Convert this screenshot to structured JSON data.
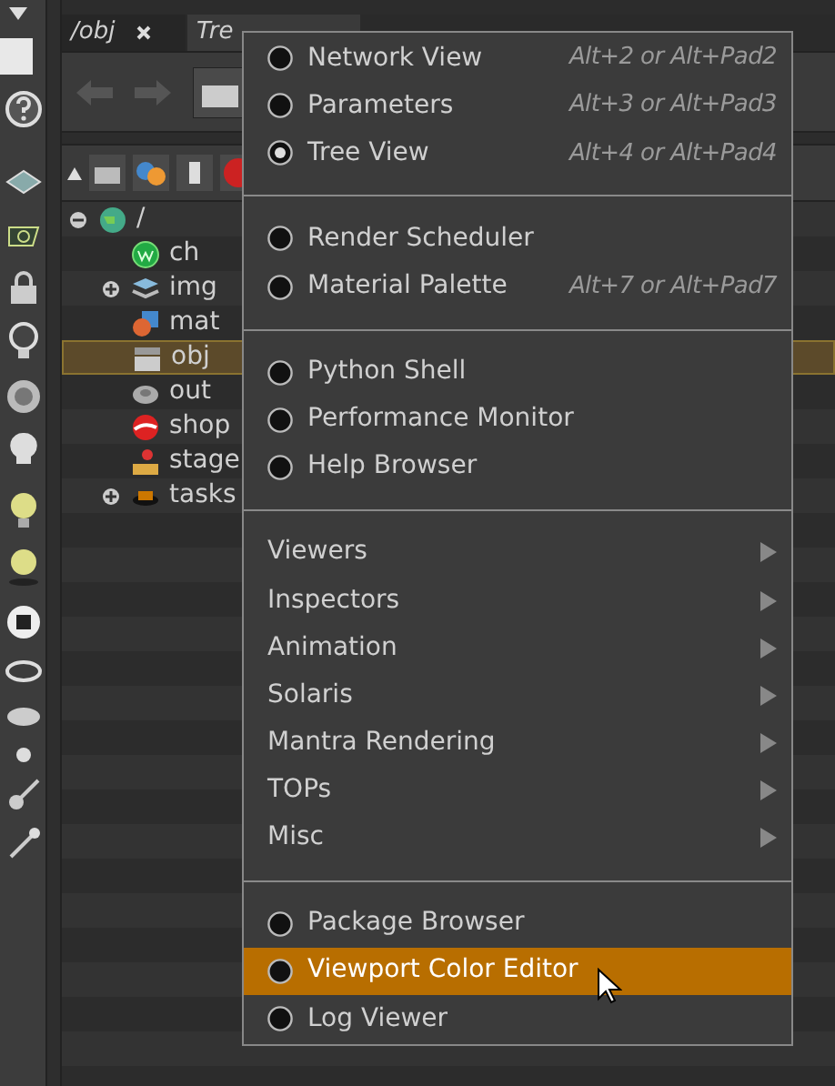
{
  "tabs": [
    {
      "label": "/obj",
      "selected": false,
      "closable": true
    },
    {
      "label": "Tre",
      "selected": true,
      "closable": false
    }
  ],
  "tree": [
    {
      "label": "/",
      "expanded": true,
      "selected": false,
      "children": [
        {
          "label": "ch",
          "selected": false
        },
        {
          "label": "img",
          "selected": false,
          "expanded": false
        },
        {
          "label": "mat",
          "selected": false
        },
        {
          "label": "obj",
          "selected": true
        },
        {
          "label": "out",
          "selected": false
        },
        {
          "label": "shop",
          "selected": false
        },
        {
          "label": "stage",
          "selected": false
        },
        {
          "label": "tasks",
          "selected": false,
          "expanded": false
        }
      ]
    }
  ],
  "menu": [
    {
      "kind": "radio",
      "label": "Network View",
      "shortcut": "Alt+2 or Alt+Pad2",
      "checked": false,
      "selected": false
    },
    {
      "kind": "radio",
      "label": "Parameters",
      "shortcut": "Alt+3 or Alt+Pad3",
      "checked": false,
      "selected": false
    },
    {
      "kind": "radio",
      "label": "Tree View",
      "shortcut": "Alt+4 or Alt+Pad4",
      "checked": true,
      "selected": false
    },
    {
      "kind": "separator"
    },
    {
      "kind": "radio",
      "label": "Render Scheduler",
      "checked": false,
      "selected": false
    },
    {
      "kind": "radio",
      "label": "Material Palette",
      "shortcut": "Alt+7 or Alt+Pad7",
      "checked": false,
      "selected": false
    },
    {
      "kind": "separator"
    },
    {
      "kind": "radio",
      "label": "Python Shell",
      "checked": false,
      "selected": false
    },
    {
      "kind": "radio",
      "label": "Performance Monitor",
      "checked": false,
      "selected": false
    },
    {
      "kind": "radio",
      "label": "Help Browser",
      "checked": false,
      "selected": false
    },
    {
      "kind": "separator"
    },
    {
      "kind": "submenu",
      "label": "Viewers",
      "selected": false
    },
    {
      "kind": "submenu",
      "label": "Inspectors",
      "selected": false
    },
    {
      "kind": "submenu",
      "label": "Animation",
      "selected": false
    },
    {
      "kind": "submenu",
      "label": "Solaris",
      "selected": false
    },
    {
      "kind": "submenu",
      "label": "Mantra Rendering",
      "selected": false
    },
    {
      "kind": "submenu",
      "label": "TOPs",
      "selected": false
    },
    {
      "kind": "submenu",
      "label": "Misc",
      "selected": false
    },
    {
      "kind": "separator"
    },
    {
      "kind": "radio",
      "label": "Package Browser",
      "checked": false,
      "selected": false
    },
    {
      "kind": "radio",
      "label": "Viewport Color Editor",
      "checked": false,
      "selected": true
    },
    {
      "kind": "radio",
      "label": "Log Viewer",
      "checked": false,
      "selected": false
    }
  ]
}
